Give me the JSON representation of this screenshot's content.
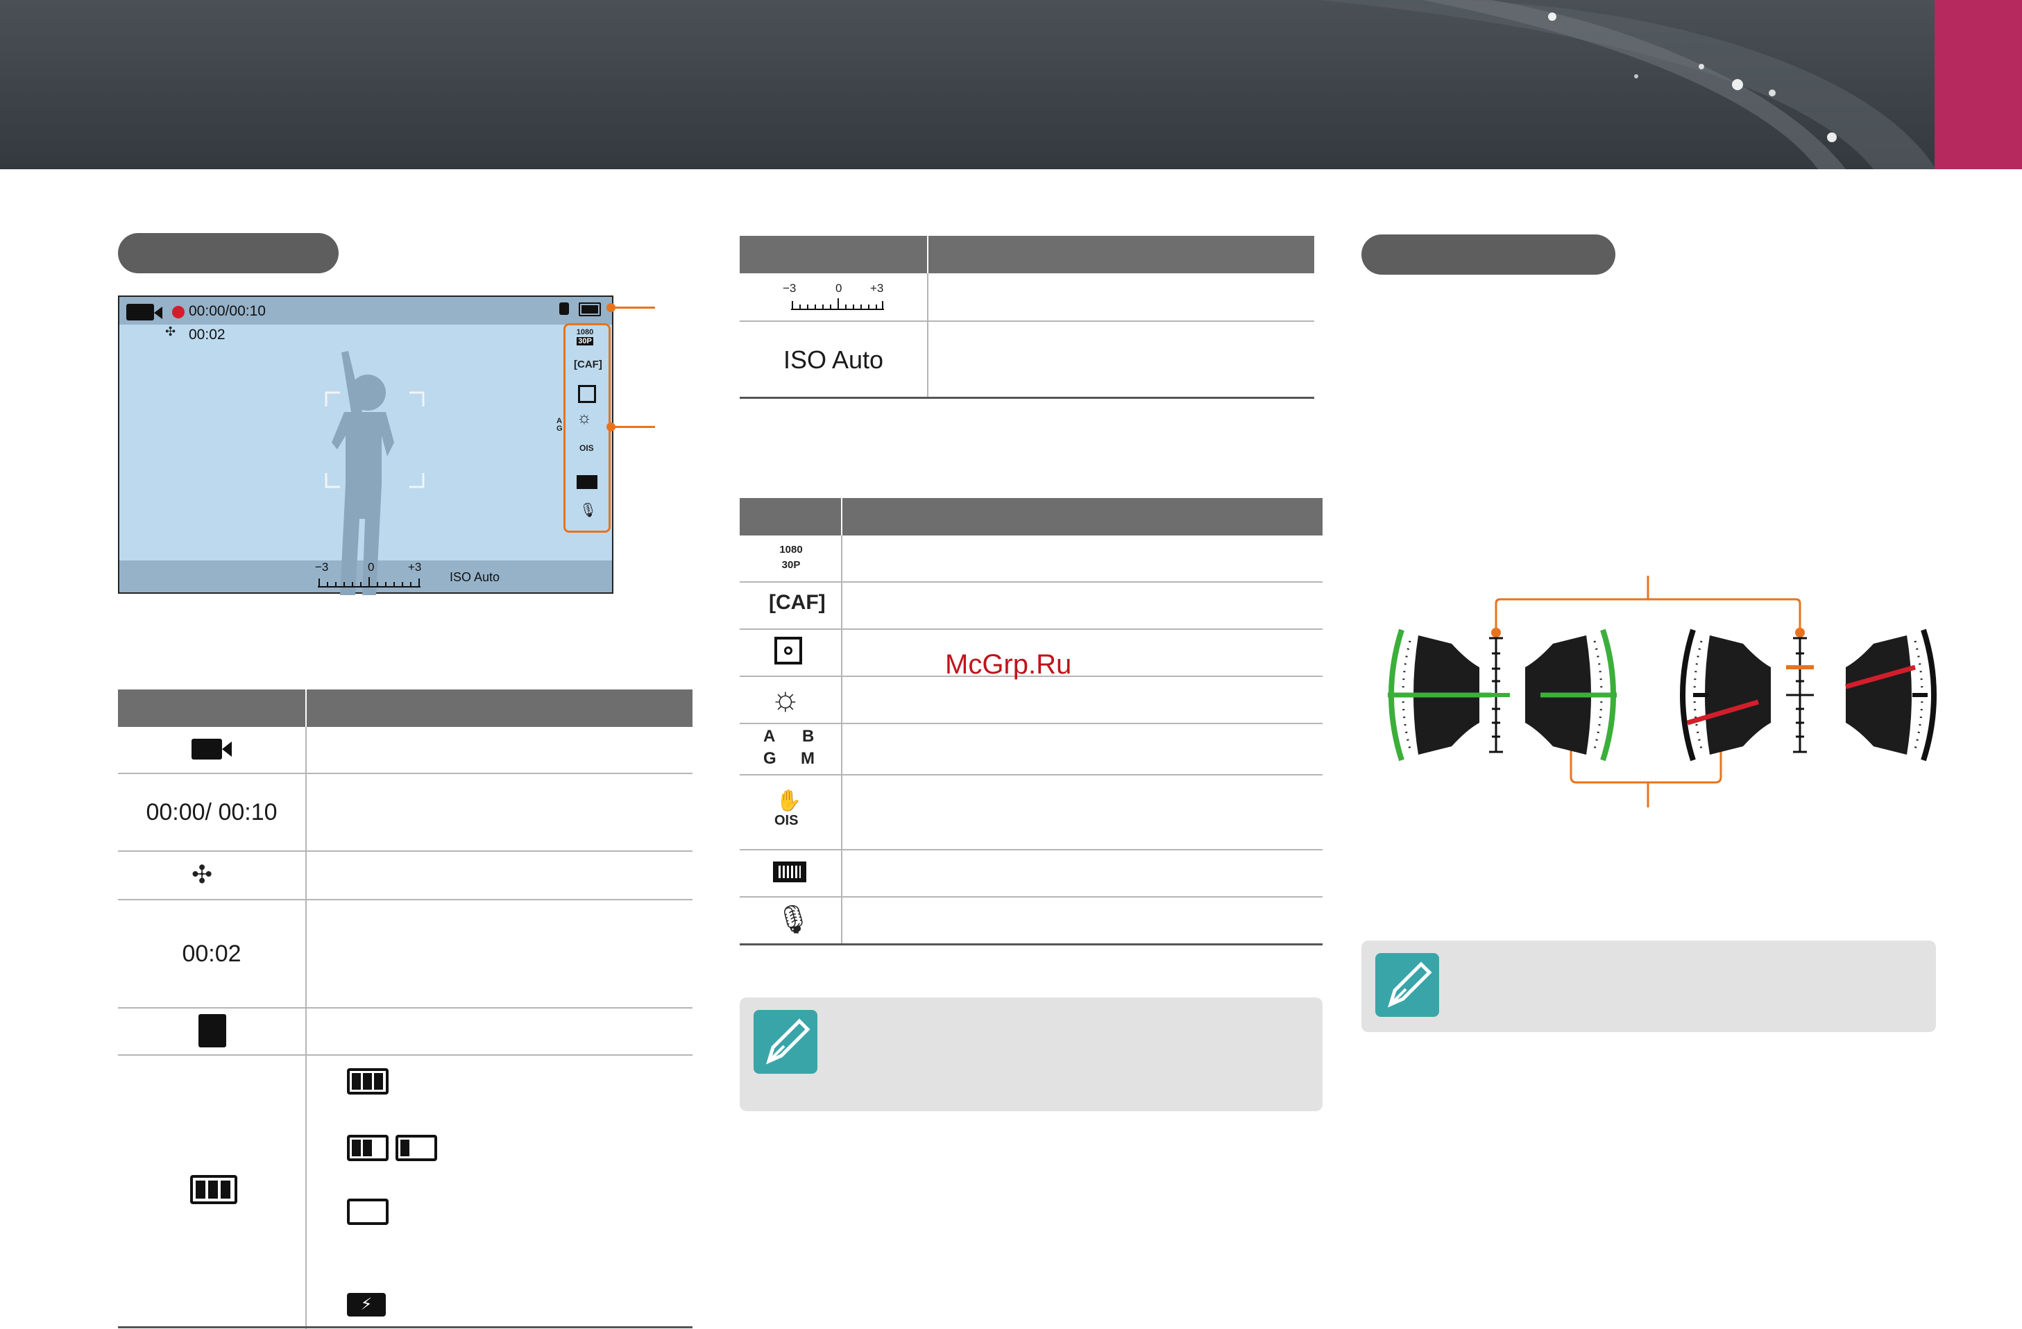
{
  "watermark": "McGrp.Ru",
  "screen": {
    "rec_time": "00:00/00:10",
    "elapsed": "00:02",
    "ev_scale": {
      "minus": "−3",
      "zero": "0",
      "plus": "+3"
    },
    "iso": "ISO Auto"
  },
  "exposure_table": {
    "scale": {
      "minus": "−3",
      "zero": "0",
      "plus": "+3"
    },
    "iso": "ISO Auto"
  },
  "info_table": {
    "rows": [
      {
        "icon": "movie-mode-icon",
        "text": ""
      },
      {
        "icon": "",
        "text": "00:00/ 00:10"
      },
      {
        "icon": "wind-cut-icon",
        "text": ""
      },
      {
        "icon": "",
        "text": "00:02"
      },
      {
        "icon": "memory-card-icon",
        "text": ""
      },
      {
        "icon": "battery-icon",
        "text": ""
      }
    ]
  },
  "options_table": {
    "rows": [
      {
        "icon": "movie-size-1080-30p-icon",
        "label": "1080 30P"
      },
      {
        "icon": "caf-icon",
        "label": "CAF"
      },
      {
        "icon": "metering-icon"
      },
      {
        "icon": "white-balance-icon"
      },
      {
        "icon": "wb-adjust-icon",
        "labels": [
          "A",
          "B",
          "G",
          "M"
        ]
      },
      {
        "icon": "ois-icon",
        "label": "OIS"
      },
      {
        "icon": "cinema-frame-icon"
      },
      {
        "icon": "voice-mute-icon"
      }
    ]
  },
  "colors": {
    "header_accent": "#b5295f",
    "orange": "#e8731c",
    "green": "#3cae3a",
    "red": "#d21e2b",
    "note_icon": "#3aa5a8"
  }
}
